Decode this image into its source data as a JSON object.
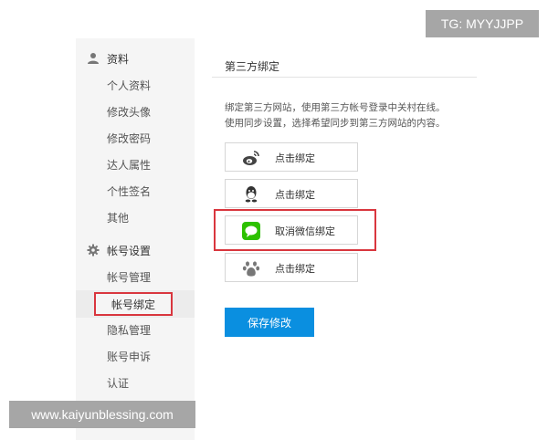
{
  "watermarks": {
    "top": "TG: MYYJJPP",
    "bottom": "www.kaiyunblessing.com"
  },
  "sidebar": {
    "section_profile": {
      "label": "资料",
      "icon": "user-icon",
      "items": [
        "个人资料",
        "修改头像",
        "修改密码",
        "达人属性",
        "个性签名",
        "其他"
      ]
    },
    "section_account": {
      "label": "帐号设置",
      "icon": "gear-icon",
      "items": [
        "帐号管理",
        "帐号绑定",
        "隐私管理",
        "账号申诉",
        "认证"
      ],
      "active": "帐号绑定"
    }
  },
  "main": {
    "title": "第三方绑定",
    "description": [
      "绑定第三方网站，使用第三方帐号登录中关村在线。",
      "使用同步设置，选择希望同步到第三方网站的内容。"
    ],
    "bindings": [
      {
        "service_icon": "weibo-icon",
        "label": "点击绑定"
      },
      {
        "service_icon": "qq-icon",
        "label": "点击绑定"
      },
      {
        "service_icon": "wechat-icon",
        "label": "取消微信绑定"
      },
      {
        "service_icon": "baidu-icon",
        "label": "点击绑定"
      }
    ],
    "save_label": "保存修改"
  },
  "colors": {
    "accent": "#0a8fe0",
    "highlight": "#d9363e",
    "wechat": "#2dc100"
  }
}
